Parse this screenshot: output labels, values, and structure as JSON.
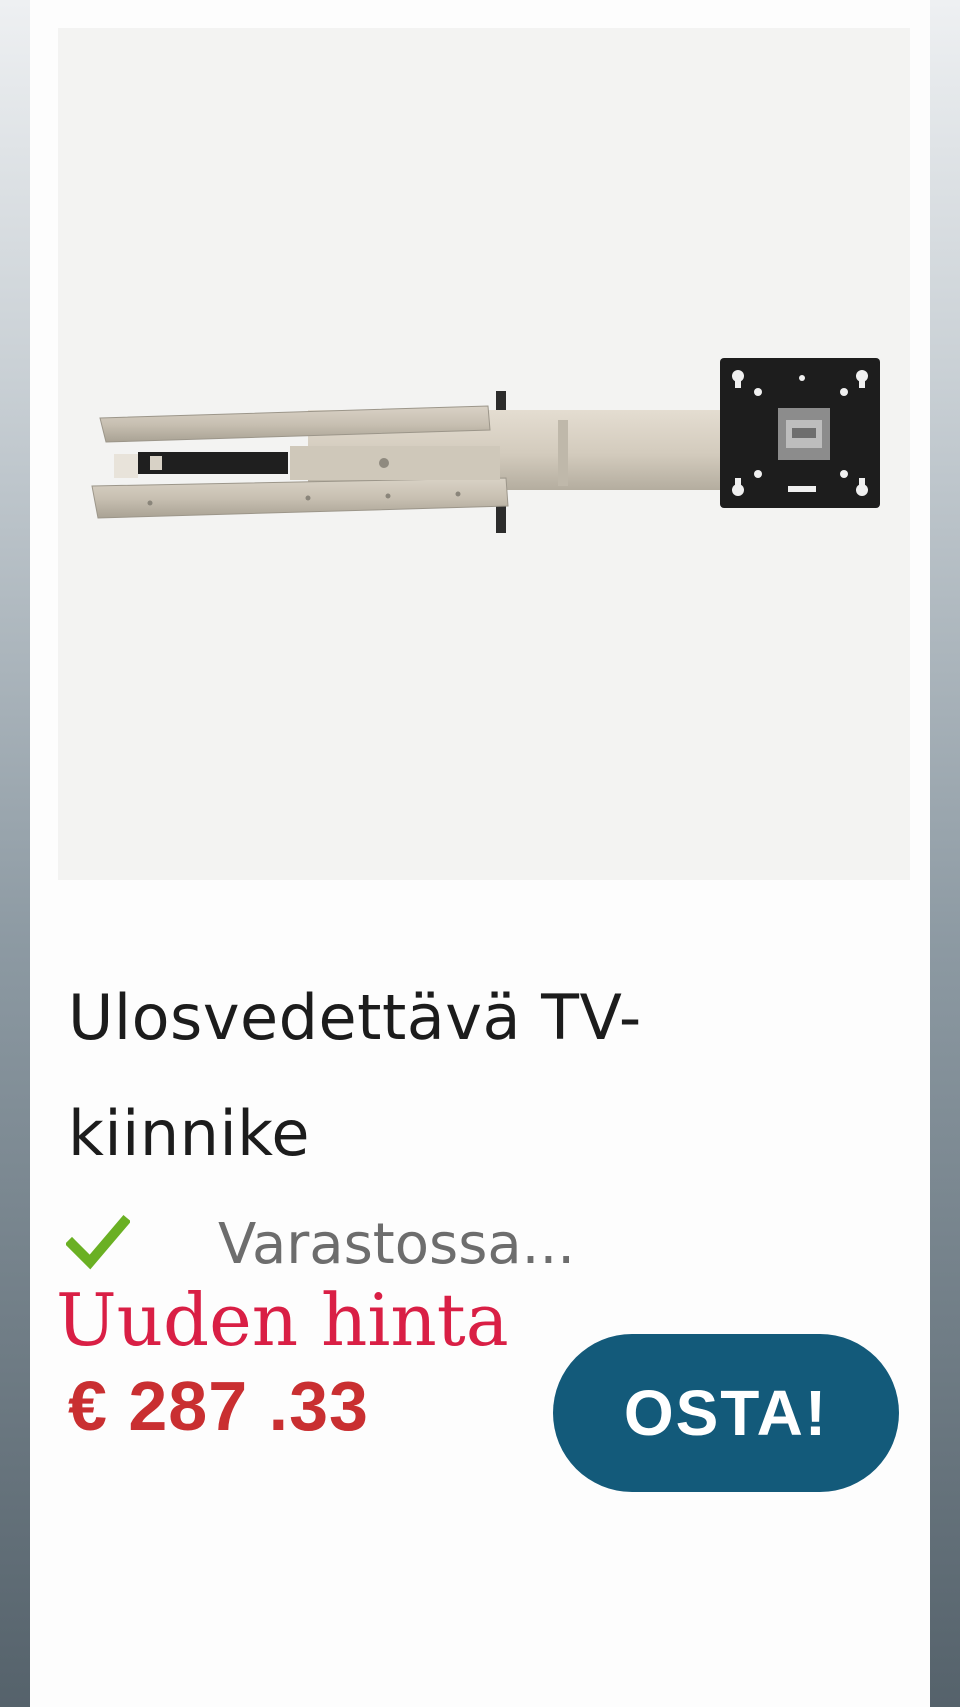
{
  "product": {
    "image_alt": "TV-kiinnike",
    "title": "Ulosvedettävä TV-kiinnike",
    "stock_status": "Varastossa...",
    "stock_icon": "check-icon",
    "promo_label": "Uuden hinta",
    "price": "€ 287 .33"
  },
  "actions": {
    "buy_label": "OSTA!"
  },
  "colors": {
    "price": "#c92f31",
    "promo": "#d91f45",
    "button": "#135a7a",
    "check": "#6ab023"
  }
}
